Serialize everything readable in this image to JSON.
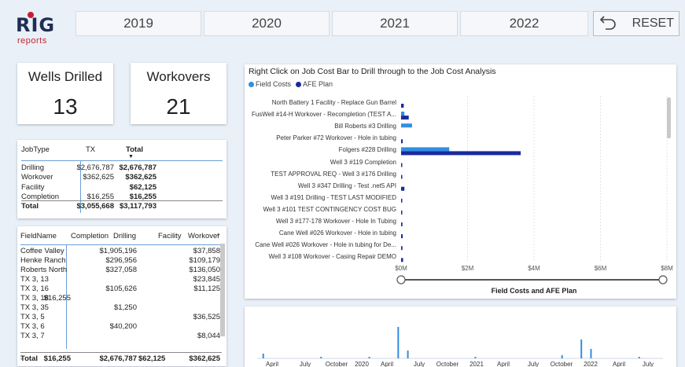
{
  "logo": {
    "main": "RIG",
    "sub": "reports"
  },
  "years": [
    "2019",
    "2020",
    "2021",
    "2022"
  ],
  "reset_label": "RESET",
  "kpis": [
    {
      "title": "Wells Drilled",
      "value": "13"
    },
    {
      "title": "Workovers",
      "value": "21"
    }
  ],
  "jobtype_table": {
    "headers": [
      "JobType",
      "TX",
      "Total"
    ],
    "rows": [
      [
        "Drilling",
        "$2,676,787",
        "$2,676,787"
      ],
      [
        "Workover",
        "$362,625",
        "$362,625"
      ],
      [
        "Facility",
        "",
        "$62,125"
      ],
      [
        "Completion",
        "$16,255",
        "$16,255"
      ]
    ],
    "total": [
      "Total",
      "$3,055,668",
      "$3,117,793"
    ]
  },
  "field_table": {
    "headers": [
      "FieldName",
      "Completion",
      "Drilling",
      "Facility",
      "Workover"
    ],
    "rows": [
      [
        "Coffee Valley",
        "",
        "$1,905,196",
        "",
        "$37,858"
      ],
      [
        "Henke Ranch",
        "",
        "$296,956",
        "",
        "$109,179"
      ],
      [
        "Roberts North",
        "",
        "$327,058",
        "",
        "$136,050"
      ],
      [
        "TX 3, 13",
        "",
        "",
        "",
        "$23,845"
      ],
      [
        "TX 3, 16",
        "",
        "$105,626",
        "",
        "$11,125"
      ],
      [
        "TX 3, 18",
        "$16,255",
        "",
        "",
        ""
      ],
      [
        "TX 3, 35",
        "",
        "$1,250",
        "",
        ""
      ],
      [
        "TX 3, 5",
        "",
        "",
        "",
        "$36,525"
      ],
      [
        "TX 3, 6",
        "",
        "$40,200",
        "",
        ""
      ],
      [
        "TX 3, 7",
        "",
        "",
        "",
        "$8,044"
      ]
    ],
    "total": [
      "Total",
      "$16,255",
      "$2,676,787",
      "$62,125",
      "$362,625"
    ]
  },
  "bar_chart_title": "Right Click on Job Cost Bar to Drill through to the Job Cost Analysis",
  "colors": {
    "field_costs": "#2f8fe3",
    "afe_plan": "#1a2a9e",
    "accent": "#1f2e54"
  },
  "chart_data": [
    {
      "type": "bar",
      "orientation": "horizontal",
      "title": "Right Click on Job Cost Bar to Drill through to the Job Cost Analysis",
      "xlabel": "Field Costs and AFE Plan",
      "xlim": [
        0,
        8000000
      ],
      "x_ticks": [
        "$0M",
        "$2M",
        "$4M",
        "$6M",
        "$8M"
      ],
      "legend_position": "top-left",
      "categories": [
        "North Battery 1 Facility - Replace Gun Barrel",
        "FusWell #14-H Workover - Recompletion (TEST A...",
        "Bill Roberts #3 Drilling",
        "Peter Parker #72 Workover - Hole in tubing",
        "Folgers #228 Drilling",
        "Well 3 #119 Completion",
        "TEST APPROVAL REQ - Well 3 #176 Drilling",
        "Well 3 #347 Drilling - Test .net5 API",
        "Well 3 #191 Drilling - TEST LAST MODIFIED",
        "Well 3 #101 TEST CONTINGENCY COST BUG",
        "Well 3 #177-178 Workover - Hole In Tubing",
        "Cane Well #026 Workover - Hole in tubing",
        "Cane Well #026 Workover - Hole in tubing for De...",
        "Well 3 #108 Workover - Casing Repair DEMO"
      ],
      "series": [
        {
          "name": "Field Costs",
          "values": [
            0,
            100000,
            330000,
            0,
            1450000,
            0,
            0,
            0,
            0,
            0,
            0,
            0,
            0,
            0
          ]
        },
        {
          "name": "AFE Plan",
          "values": [
            80000,
            230000,
            0,
            50000,
            3600000,
            30000,
            30000,
            100000,
            20000,
            20000,
            40000,
            50000,
            40000,
            60000
          ]
        }
      ]
    },
    {
      "type": "bar",
      "title": "",
      "x_ticks": [
        "April",
        "July",
        "October",
        "2020",
        "April",
        "July",
        "October",
        "2021",
        "April",
        "July",
        "October",
        "2022",
        "April",
        "July"
      ],
      "spikes": [
        {
          "x": "2019-03",
          "value": 0.15
        },
        {
          "x": "2019-09",
          "value": 0.05
        },
        {
          "x": "2020-02",
          "value": 0.05
        },
        {
          "x": "2020-05",
          "value": 1.0
        },
        {
          "x": "2020-06",
          "value": 0.25
        },
        {
          "x": "2021-01",
          "value": 0.05
        },
        {
          "x": "2021-10",
          "value": 0.1
        },
        {
          "x": "2021-12",
          "value": 0.6
        },
        {
          "x": "2022-01",
          "value": 0.3
        },
        {
          "x": "2022-06",
          "value": 0.05
        }
      ]
    }
  ]
}
